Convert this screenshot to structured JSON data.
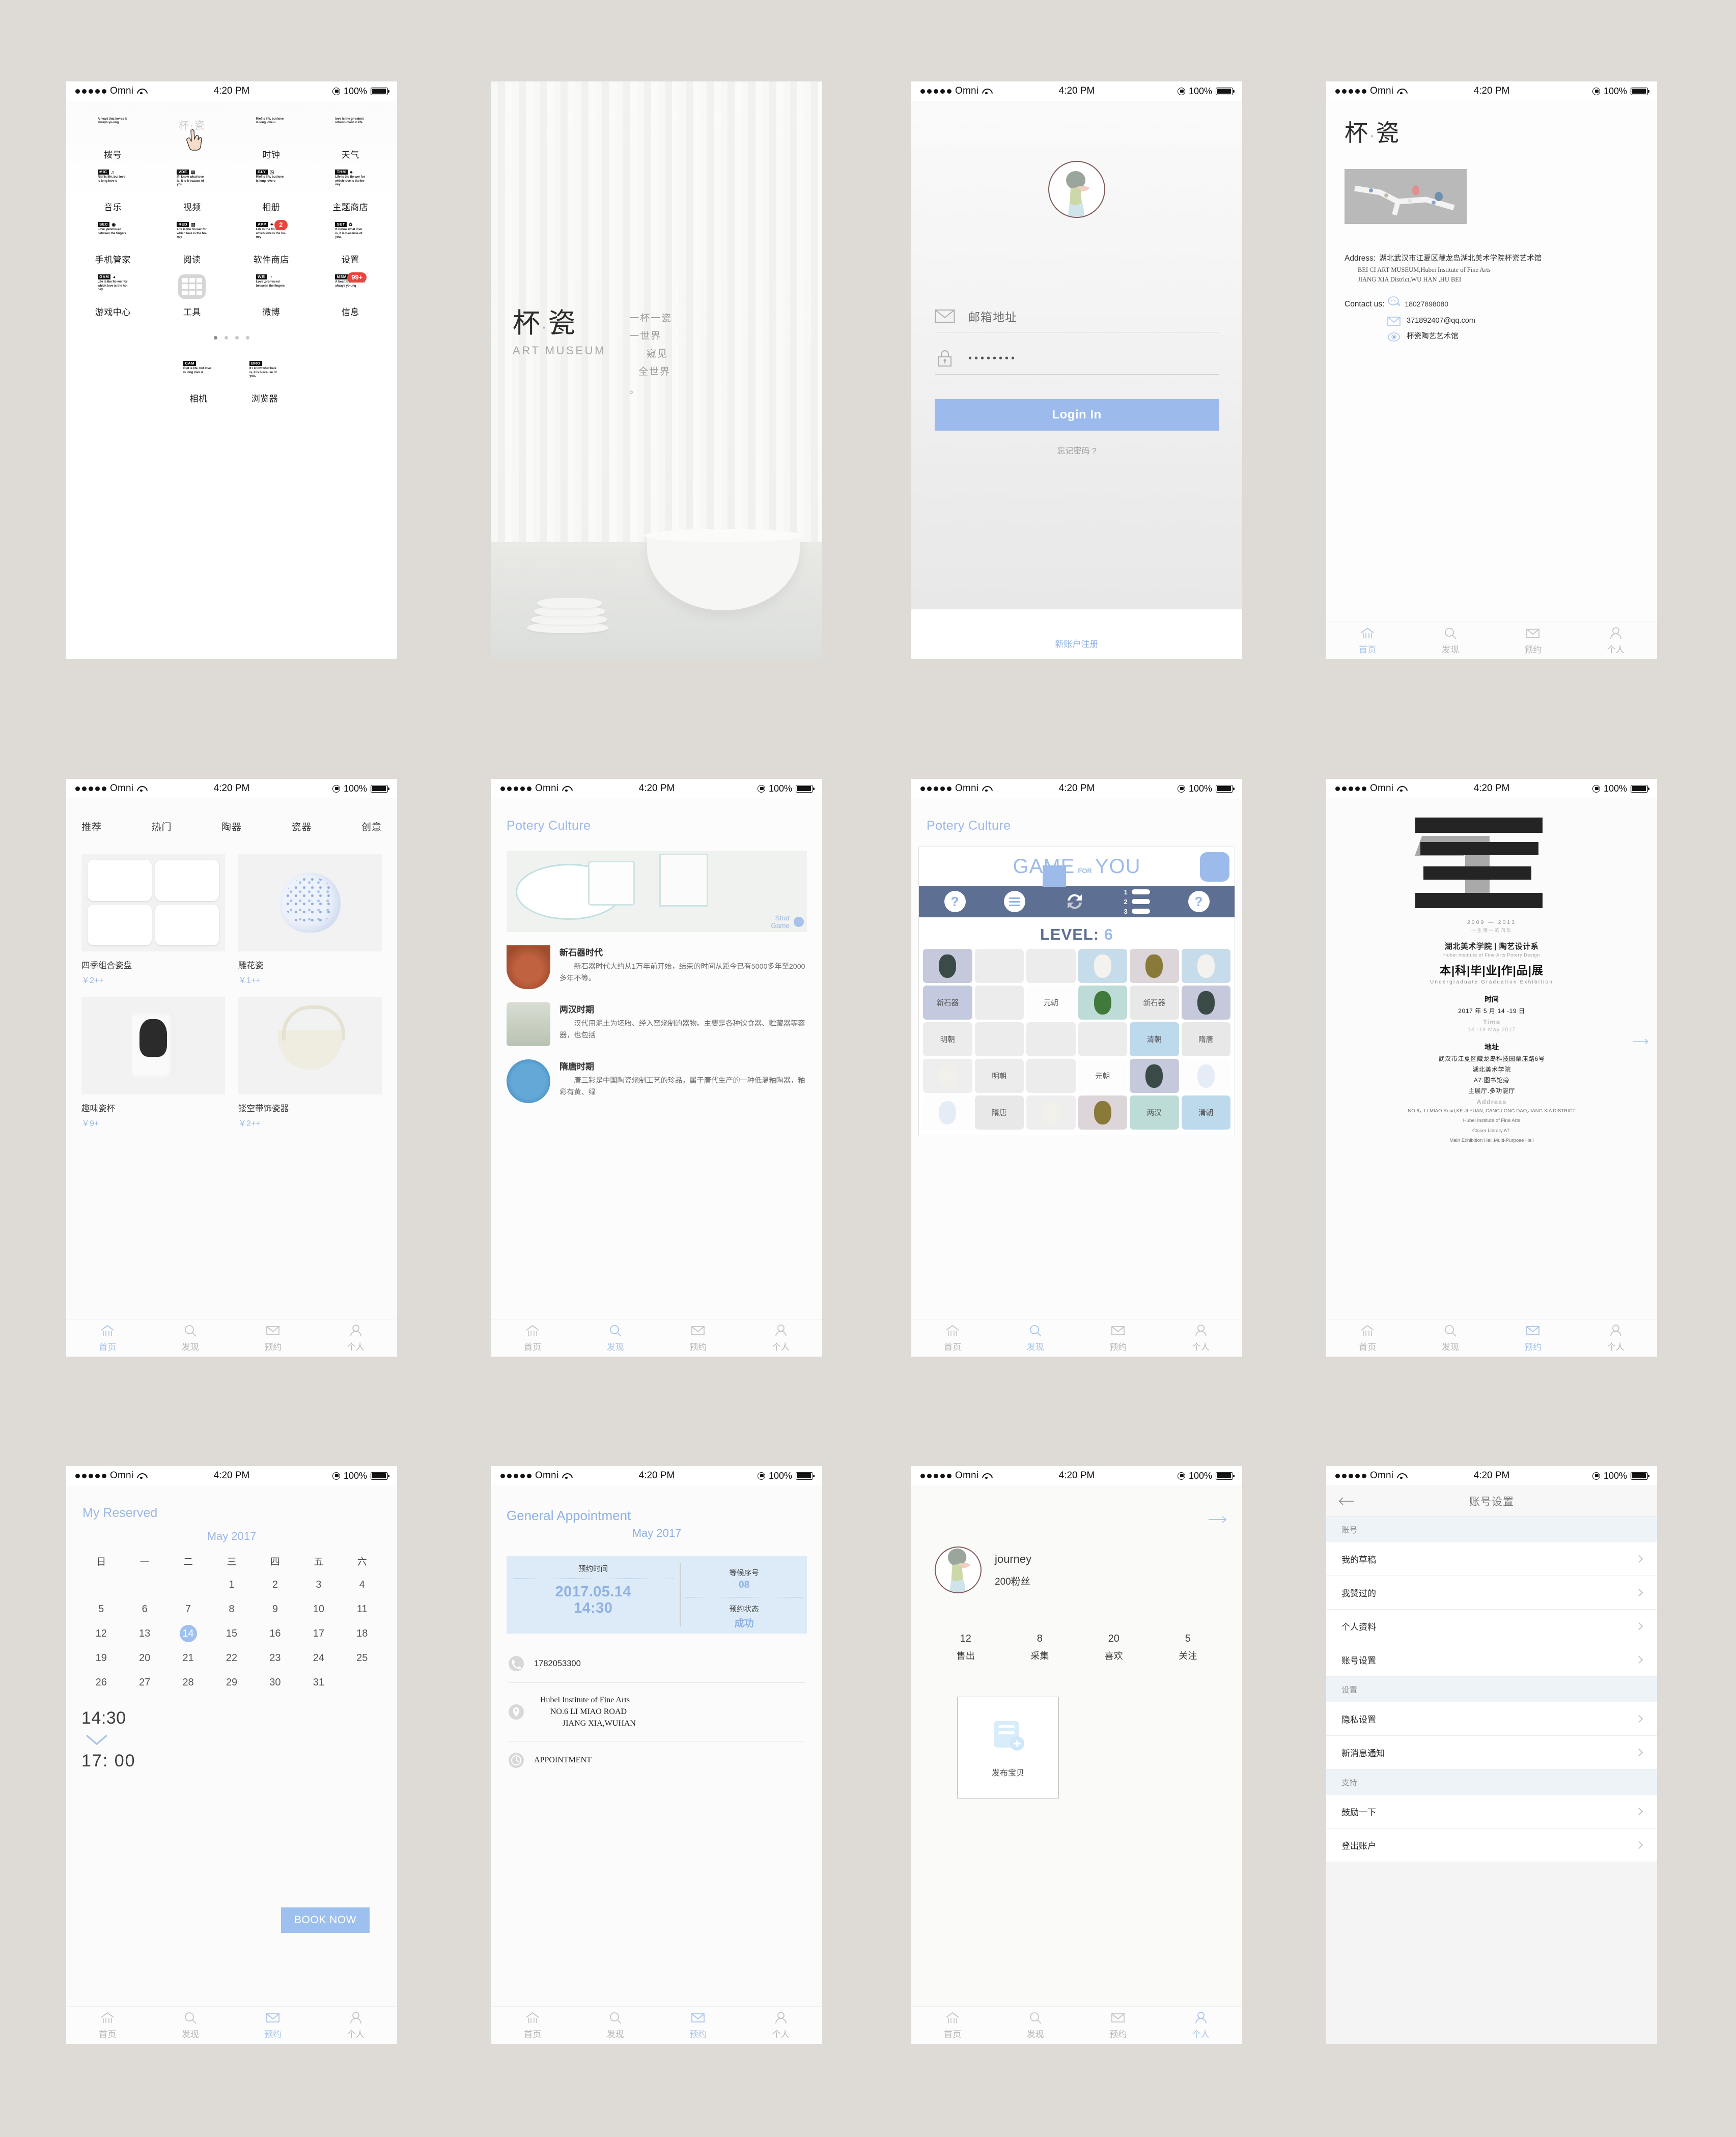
{
  "statusbar": {
    "carrier": "Omni",
    "time": "4:20 PM",
    "battery": "100%"
  },
  "tabbar": {
    "home": "首页",
    "discover": "发现",
    "appointment": "预约",
    "personal": "个人"
  },
  "brand": {
    "cn_left": "杯",
    "cn_dot": "·",
    "cn_right": "瓷",
    "en": "ART MUSEUM"
  },
  "home": {
    "apps": [
      {
        "label": "拨号",
        "tag": "",
        "desc": "A heart that lov-es is always yo-ung"
      },
      {
        "label": "",
        "tag": "",
        "desc": "",
        "logo": true
      },
      {
        "label": "时钟",
        "tag": "",
        "desc": "Rief is life, but love is long love u"
      },
      {
        "label": "天气",
        "tag": "",
        "desc": "love is the gr-eatest refresh-ment in life"
      },
      {
        "label": "音乐",
        "tag": "MIC",
        "glyph": "♫",
        "desc": "Rief is life, but love is long love u"
      },
      {
        "label": "视频",
        "tag": "VDE",
        "glyph": "▤",
        "desc": "If i know what love is, it is b-ecause of you."
      },
      {
        "label": "相册",
        "tag": "GLY",
        "glyph": "◳",
        "desc": "Rief is life, but love is long love u"
      },
      {
        "label": "主题商店",
        "tag": "THM",
        "glyph": "♣",
        "desc": "Life is the flo-wer for which love is the ho-ney"
      },
      {
        "label": "手机管家",
        "tag": "SEC",
        "glyph": "◉",
        "desc": "Love ,promis-ed between the fingers"
      },
      {
        "label": "阅读",
        "tag": "RED",
        "glyph": "▥",
        "desc": "Life is the flo-wer for which love is the ho-ney"
      },
      {
        "label": "软件商店",
        "tag": "APP",
        "glyph": "✦",
        "desc": "Life is the flo-wer for which love is the ho-ney",
        "badge": "2"
      },
      {
        "label": "设置",
        "tag": "SET",
        "glyph": "✿",
        "desc": "If i know what love is, it is b-ecause of you."
      },
      {
        "label": "游戏中心",
        "tag": "GAM",
        "glyph": "◕",
        "desc": "Life is the flo-wer for which love is the ho-ney"
      },
      {
        "label": "工具",
        "tag": "",
        "desc": "",
        "folder": true
      },
      {
        "label": "微博",
        "tag": "WEI",
        "glyph": "◔",
        "desc": "Love ,promis-ed between the fingers"
      },
      {
        "label": "信息",
        "tag": "MSM",
        "glyph": "✉",
        "desc": "A heart that lov-es is always yo-ung",
        "badge": "99+"
      }
    ],
    "dock": [
      {
        "label": "相机",
        "tag": "CAM",
        "desc": "Rief is life, but love is long love u"
      },
      {
        "label": "浏览器",
        "tag": "BRO",
        "desc": "If i know what love is, it is b-ecause of you."
      }
    ]
  },
  "splash": {
    "tagline": [
      "一杯一瓷",
      "一世界",
      "窥见",
      "全世界",
      "。"
    ]
  },
  "login": {
    "email_value": "邮箱地址",
    "password_value": "••••••••",
    "login_label": "Login In",
    "forgot_label": "忘记密码 ?",
    "register_label": "新账户注册"
  },
  "about": {
    "address_label": "Address:",
    "address_cn": "湖北武汉市江夏区藏龙岛湖北美术学院杯瓷艺术馆",
    "address_en1": "BEI CI ART MUSEUM,Hubei Institute of Fine Arts",
    "address_en2": "JIANG XIA District,WU HAN ,HU BEI",
    "contact_label": "Contact us:",
    "phone": "18027898080",
    "email": "371892407@qq.com",
    "weibo": "杯瓷陶艺艺术馆"
  },
  "shop": {
    "tabs": [
      "推荐",
      "热门",
      "陶器",
      "瓷器",
      "创意"
    ],
    "products": [
      {
        "name": "四季组合瓷盘",
        "price": "￥2++",
        "art": "plates"
      },
      {
        "name": "雕花瓷",
        "price": "￥1++",
        "art": "vase"
      },
      {
        "name": "趣味瓷杯",
        "price": "￥9+",
        "art": "mug"
      },
      {
        "name": "镂空带饰瓷器",
        "price": "￥2++",
        "art": "basket"
      }
    ]
  },
  "pottery": {
    "title": "Potery Culture",
    "start_game": [
      "Strat",
      "Game"
    ],
    "timeline": [
      {
        "era": "新石器时代",
        "text": "新石器时代大约从1万年前开始，结束的时间从距今已有5000多年至2000多年不等。"
      },
      {
        "era": "两汉时期",
        "text": "汉代用泥土为坯胎、经入窑烧制的器物。主要是各种饮食器、贮藏器等容器，也包括"
      },
      {
        "era": "隋唐时期",
        "text": "唐三彩是中国陶瓷烧制工艺的珍品，属于唐代生产的一种低温釉陶器，釉彩有黄、绿"
      }
    ]
  },
  "game": {
    "title": "Potery Culture",
    "banner_game": "GAME",
    "banner_for": "FOR",
    "banner_you": "YOU",
    "level_label": "LEVEL:",
    "level_value": "6",
    "list_numbers": [
      "1",
      "2",
      "3"
    ],
    "cells": [
      {
        "t": "",
        "k": "img1"
      },
      {
        "t": "",
        "k": "e"
      },
      {
        "t": "",
        "k": "e"
      },
      {
        "t": "",
        "k": "img2"
      },
      {
        "t": "",
        "k": "img3"
      },
      {
        "t": "",
        "k": "img2"
      },
      {
        "t": "新石器",
        "k": "p"
      },
      {
        "t": "",
        "k": "e"
      },
      {
        "t": "元朝",
        "k": "w"
      },
      {
        "t": "",
        "k": "img4"
      },
      {
        "t": "新石器",
        "k": "g"
      },
      {
        "t": "",
        "k": "img1"
      },
      {
        "t": "明朝",
        "k": "e"
      },
      {
        "t": "",
        "k": "e"
      },
      {
        "t": "",
        "k": "e"
      },
      {
        "t": "",
        "k": "e"
      },
      {
        "t": "清朝",
        "k": "b"
      },
      {
        "t": "隋唐",
        "k": "g"
      },
      {
        "t": "",
        "k": "img5"
      },
      {
        "t": "明朝",
        "k": "e"
      },
      {
        "t": "",
        "k": "e"
      },
      {
        "t": "元朝",
        "k": "w"
      },
      {
        "t": "",
        "k": "img1"
      },
      {
        "t": "",
        "k": "img6"
      },
      {
        "t": "",
        "k": "img6"
      },
      {
        "t": "隋唐",
        "k": "g"
      },
      {
        "t": "",
        "k": "img5"
      },
      {
        "t": "",
        "k": "img3"
      },
      {
        "t": "两汉",
        "k": "t"
      },
      {
        "t": "清朝",
        "k": "b"
      }
    ]
  },
  "poster": {
    "years": "2009 — 2013",
    "sub": "一生唯一的四年",
    "org_cn": "湖北美术学院 | 陶艺设计系",
    "org_en": "Hubei Institute of Fine Arts    Potery Design",
    "main_cn": "本|科|毕|业|作|品|展",
    "main_en": "Undergraduate  Graduation  Exhibition",
    "time_label": "时间",
    "time_cn": "2017 年 5 月 14 -19 日",
    "time_en_label": "Time",
    "time_en": "14 -19 May 2017",
    "addr_label": "地址",
    "addr_cn1": "武汉市江夏区藏龙岛科技园栗庙路6号",
    "addr_cn2": "湖北美术学院",
    "addr_cn3": "A7.图书馆旁",
    "addr_cn4": "主展厅.多功能厅",
    "addr_en_label": "Address",
    "addr_en1": "NO.6，LI MIAO Road,KE JI YUAN,.CANG LONG DAO,JIANG XIA DISTRICT",
    "addr_en2": "Hubei Institute of Fine Arts",
    "addr_en3": "Closer Library,A7.",
    "addr_en4": "Main Exhibition Hall,Multi-Purpose Hall"
  },
  "calendar": {
    "title": "My Reserved",
    "month": "May 2017",
    "dow": [
      "日",
      "一",
      "二",
      "三",
      "四",
      "五",
      "六"
    ],
    "blank_leading": 3,
    "days": [
      1,
      2,
      3,
      4,
      5,
      6,
      7,
      8,
      9,
      10,
      11,
      12,
      13,
      14,
      15,
      16,
      17,
      18,
      19,
      20,
      21,
      22,
      23,
      24,
      25,
      26,
      27,
      28,
      29,
      30,
      31
    ],
    "selected": 14,
    "time_start": "14:30",
    "time_end": "17:  00",
    "book_label": "BOOK NOW"
  },
  "appointment": {
    "title": "General Appointment",
    "month": "May 2017",
    "time_label": "预约时间",
    "date_line1": "2017.05.14",
    "date_line2": "14:30",
    "queue_label": "等候序号",
    "queue_value": "08",
    "status_label": "预约状态",
    "status_value": "成功",
    "phone": "1782053300",
    "addr1": "Hubei Institute of Fine Arts",
    "addr2": "NO.6 LI MIAO ROAD",
    "addr3": "JIANG XIA,WUHAN",
    "type": "APPOINTMENT"
  },
  "profile": {
    "name": "journey",
    "fans": "200粉丝",
    "stats": [
      {
        "n": "12",
        "l": "售出"
      },
      {
        "n": "8",
        "l": "采集"
      },
      {
        "n": "20",
        "l": "喜欢"
      },
      {
        "n": "5",
        "l": "关注"
      }
    ],
    "publish_label": "发布宝贝"
  },
  "settings": {
    "title": "账号设置",
    "groups": [
      {
        "header": "账号",
        "items": [
          "我的草稿",
          "我赞过的",
          "个人资料",
          "账号设置"
        ]
      },
      {
        "header": "设置",
        "items": [
          "隐私设置",
          "新消息通知"
        ]
      },
      {
        "header": "支持",
        "items": [
          "鼓励一下",
          "登出账户"
        ]
      }
    ]
  },
  "colors": {
    "accent": "#9bb7e6",
    "button": "#9ec0ef",
    "badge": "#e8453c",
    "gamebar": "#5d6f93"
  }
}
